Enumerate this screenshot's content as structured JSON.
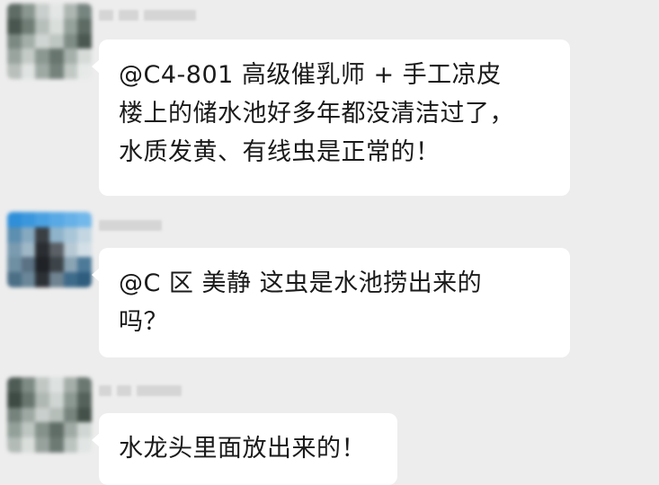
{
  "messages": [
    {
      "sender_name_redacted": true,
      "lines": [
        "@C4-801 高级催乳师 + 手工凉皮",
        "楼上的储水池好多年都没清洁过了，",
        "水质发黄、有线虫是正常的！"
      ]
    },
    {
      "sender_name_redacted": true,
      "lines": [
        "@C 区 美静  这虫是水池捞出来的",
        "吗？"
      ]
    },
    {
      "sender_name_redacted": true,
      "lines": [
        "水龙头里面放出来的！"
      ]
    }
  ],
  "colors": {
    "background": "#ededed",
    "bubble": "#ffffff",
    "text": "#1a1a1a"
  }
}
